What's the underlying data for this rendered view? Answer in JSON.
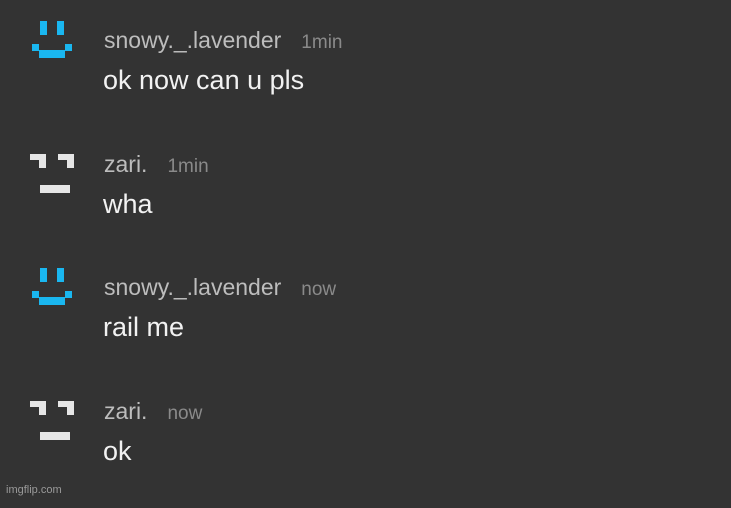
{
  "messages": [
    {
      "user": "snowy._.lavender",
      "time": "1min",
      "text": "ok now can u pls",
      "avatar": "smile-face-icon",
      "avatar_color": "#1ab7f0"
    },
    {
      "user": "zari.",
      "time": "1min",
      "text": "wha",
      "avatar": "neutral-face-icon",
      "avatar_color": "#e6e6e6"
    },
    {
      "user": "snowy._.lavender",
      "time": "now",
      "text": "rail me",
      "avatar": "smile-face-icon",
      "avatar_color": "#1ab7f0"
    },
    {
      "user": "zari.",
      "time": "now",
      "text": "ok",
      "avatar": "neutral-face-icon",
      "avatar_color": "#e6e6e6"
    }
  ],
  "watermark": "imgflip.com"
}
